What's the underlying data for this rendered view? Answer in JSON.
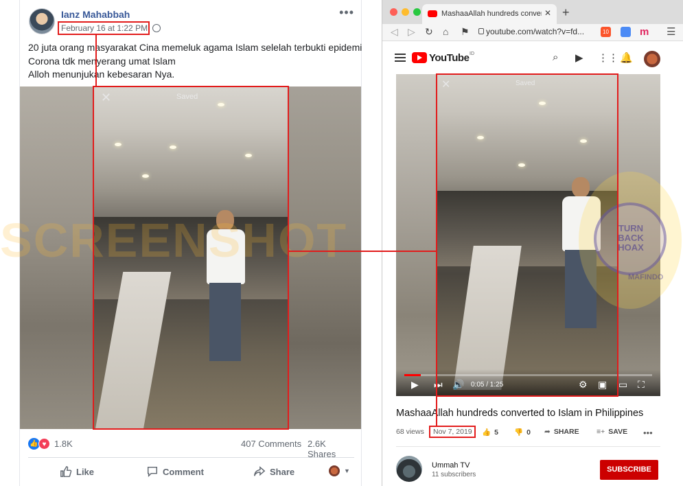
{
  "facebook": {
    "author": "Ianz Mahabbah",
    "timestamp": "February 16 at 1:22 PM",
    "more": "•••",
    "post_lines": [
      "20 juta orang masyarakat Cina memeluk agama Islam selelah terbukti epidemi",
      "Corona tdk menyerang umat Islam",
      "Alloh menunjukan kebesaran Nya."
    ],
    "video_close": "✕",
    "video_saved": "Saved",
    "reaction_count": "1.8K",
    "comments": "407 Comments",
    "shares": "2.6K Shares",
    "actions": {
      "like": "Like",
      "comment": "Comment",
      "share": "Share"
    }
  },
  "watermark": "SCREENSHOT",
  "browser": {
    "tab_title": "MashaaAllah hundreds converted",
    "tab_close": "✕",
    "new_tab": "+",
    "url": "youtube.com/watch?v=fd...",
    "ext_badge": "10",
    "ext_m": "m",
    "menu": "☰"
  },
  "youtube": {
    "logo_text": "YouTube",
    "region": "ID",
    "player_close": "✕",
    "player_saved": "Saved",
    "time": "0:05 / 1:25",
    "progress": 0.066,
    "title": "MashaaAllah hundreds converted to Islam in Philippines",
    "views": "68 views",
    "date": "Nov 7, 2019",
    "likes": "5",
    "dislikes": "0",
    "share": "SHARE",
    "save": "SAVE",
    "more": "•••",
    "channel": "Ummah TV",
    "subscribers": "11 subscribers",
    "subscribe": "SUBSCRIBE"
  },
  "stamp": {
    "line1": "TURN",
    "line2": "BACK",
    "line3": "HOAX",
    "line4": "MAFINDO"
  },
  "colors": {
    "annotation": "#e21b1b",
    "fb_blue": "#385898",
    "yt_red": "#ff0000",
    "subscribe": "#cc0000"
  }
}
